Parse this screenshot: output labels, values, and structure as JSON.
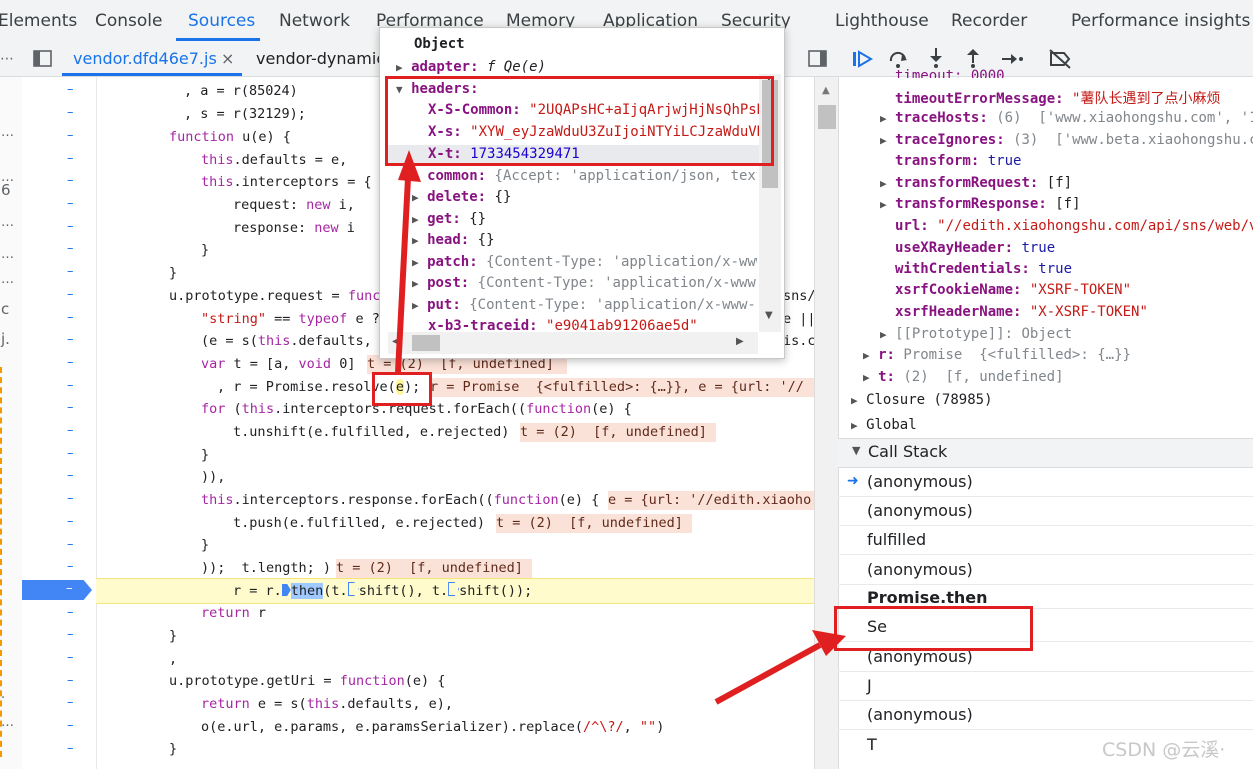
{
  "top_tabs": [
    "Elements",
    "Console",
    "Sources",
    "Network",
    "Performance",
    "Memory",
    "Application",
    "Security",
    "Lighthouse",
    "Recorder",
    "Performance insights"
  ],
  "active_top_tab": "Sources",
  "file_tabs": {
    "active": "vendor.dfd46e7.js",
    "close": "×",
    "second": "vendor-dynamic"
  },
  "gutter_left_chars": [
    "…",
    "…",
    "6",
    "…",
    "…",
    "…",
    "c",
    "j.",
    ".",
    "…"
  ],
  "code_lines": {
    "l1": ", a = r(85024)",
    "l2": ", s = r(32129);",
    "l3_kw": "function",
    "l3": " u(e) {",
    "l4a": "this",
    "l4b": ".defaults = e,",
    "l5a": "this",
    "l5b": ".interceptors = {",
    "l6a": "request: ",
    "l6b": "new",
    "l6c": " i,",
    "l7a": "response: ",
    "l7b": "new",
    "l7c": " i",
    "l8": "}",
    "l9": "}",
    "l10a": "u.prototype.request = ",
    "l10b": "func",
    "l10c": "sns/",
    "l11a": "\"string\"",
    "l11b": " == ",
    "l11c": "typeof",
    "l11d": " e ?",
    "l11e": "e ||",
    "l12a": "(e = s(",
    "l12b": "this",
    "l12c": ".defaults, e",
    "l12d": "is.c",
    "l13a": "var",
    "l13b": " t = [a, ",
    "l13c": "void",
    "l13d": " 0]",
    "l13inl": "t = (2)  [f, undefined]",
    "l14a": ", r = Promise.resolve(",
    "l14b": "e",
    "l14c": ");",
    "l14inl": "r = Promise  {<fulfilled>: {…}}, e = {url: '//",
    "l15a": "for",
    "l15b": " (",
    "l15c": "this",
    "l15d": ".interceptors.request.forEach((",
    "l15e": "function",
    "l15f": "(e) {",
    "l16": "t.unshift(e.fulfilled, e.rejected)",
    "l16inl": "t = (2)  [f, undefined]",
    "l17": "}",
    "l18": ")),",
    "l19a": "this",
    "l19b": ".interceptors.response.forEach((",
    "l19c": "function",
    "l19d": "(e) {",
    "l19inl": "e = {url: '//edith.xiaoho",
    "l20": "t.push(e.fulfilled, e.rejected)",
    "l20inl": "t = (2)  [f, undefined]",
    "l21": "}",
    "l22": "));  t.length; )",
    "l22inl": "t = (2)  [f, undefined]",
    "l23a": "r = r.",
    "l23b": "then",
    "l23c": "(t.",
    "l23d": "shift(), t.",
    "l23e": "shift());",
    "l24a": "return",
    "l24b": " r",
    "l25": "}",
    "l26": ",",
    "l27a": "u.prototype.getUri = ",
    "l27b": "function",
    "l27c": "(e) {",
    "l28a": "return",
    "l28b": " e = s(",
    "l28c": "this",
    "l28d": ".defaults, e),",
    "l29a": "o(e.url, e.params, e.paramsSerializer).replace(",
    "l29b": "/^\\?/",
    "l29c": ", ",
    "l29d": "\"\"",
    "l29e": ")",
    "l30": "}"
  },
  "popover": {
    "title": "Object",
    "adapter_key": "adapter:",
    "adapter_val": "f Qe(e)",
    "headers_key": "headers:",
    "xs_common_key": "X-S-Common:",
    "xs_common_val": "\"2UQAPsHC+aIjqArjwjHjNsQhPsH",
    "xs_key": "X-s:",
    "xs_val": "\"XYW_eyJzaWduU3ZuIjoiNTYiLCJzaWduVH",
    "xt_key": "X-t:",
    "xt_val": "1733454329471",
    "common_key": "common:",
    "common_val": "{Accept: 'application/json, text",
    "delete_key": "delete:",
    "delete_val": "{}",
    "get_key": "get:",
    "get_val": "{}",
    "head_key": "head:",
    "head_val": "{}",
    "patch_key": "patch:",
    "patch_val": "{Content-Type: 'application/x-www",
    "post_key": "post:",
    "post_val": "{Content-Type: 'application/x-www-",
    "put_key": "put:",
    "put_val": "{Content-Type: 'application/x-www-f",
    "trace_key": "x-b3-traceid:",
    "trace_val": "\"e9041ab91206ae5d\""
  },
  "scope": {
    "timeout_cut": "timeout: 0000",
    "timeoutErrorMessage_key": "timeoutErrorMessage:",
    "timeoutErrorMessage_val": "\"薯队长遇到了点小麻烦",
    "traceHosts_key": "traceHosts:",
    "traceHosts_val": "(6)  ['www.xiaohongshu.com', '1o",
    "traceIgnores_key": "traceIgnores:",
    "traceIgnores_val": "(3)  ['www.beta.xiaohongshu.co",
    "transform_key": "transform:",
    "transform_val": "true",
    "transformRequest_key": "transformRequest:",
    "transformRequest_val": "[f]",
    "transformResponse_key": "transformResponse:",
    "transformResponse_val": "[f]",
    "url_key": "url:",
    "url_val": "\"//edith.xiaohongshu.com/api/sns/web/v1/",
    "useXRayHeader_key": "useXRayHeader:",
    "useXRayHeader_val": "true",
    "withCredentials_key": "withCredentials:",
    "withCredentials_val": "true",
    "xsrfCookieName_key": "xsrfCookieName:",
    "xsrfCookieName_val": "\"XSRF-TOKEN\"",
    "xsrfHeaderName_key": "xsrfHeaderName:",
    "xsrfHeaderName_val": "\"X-XSRF-TOKEN\"",
    "prototype": "[[Prototype]]: Object",
    "r_key": "r:",
    "r_val": "Promise  {<fulfilled>: {…}}",
    "t_key": "t:",
    "t_val": "(2)  [f, undefined]",
    "closure": "Closure (78985)",
    "global": "Global"
  },
  "call_stack": {
    "header": "Call Stack",
    "items": [
      "(anonymous)",
      "(anonymous)",
      "fulfilled",
      "(anonymous)",
      "Promise.then",
      "Se",
      "(anonymous)",
      "J",
      "(anonymous)",
      "T"
    ]
  },
  "watermark": "CSDN @云溪·",
  "colors": {
    "accent": "#1a73e8",
    "annotation_red": "#e02020",
    "exec_line": "#fffbcc",
    "inline_value_bg": "#fbe2d8"
  }
}
